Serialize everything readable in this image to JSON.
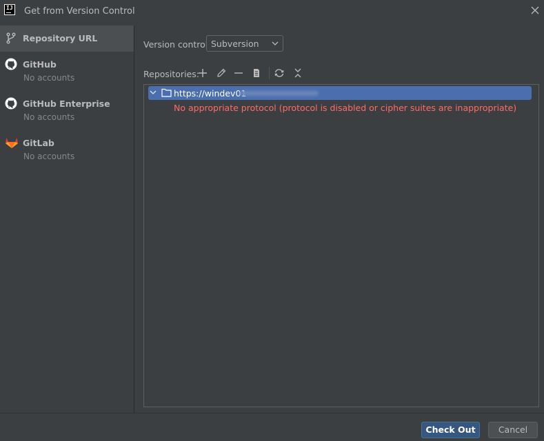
{
  "window": {
    "title": "Get from Version Control",
    "app_icon_text": "IJ"
  },
  "sidebar": {
    "items": [
      {
        "label": "Repository URL",
        "sub": "",
        "icon": "branch-icon",
        "selected": true
      },
      {
        "label": "GitHub",
        "sub": "No accounts",
        "icon": "github-icon",
        "selected": false
      },
      {
        "label": "GitHub Enterprise",
        "sub": "No accounts",
        "icon": "github-icon",
        "selected": false
      },
      {
        "label": "GitLab",
        "sub": "No accounts",
        "icon": "gitlab-icon",
        "selected": false
      }
    ]
  },
  "main": {
    "version_control_label": "Version control:",
    "version_control_value": "Subversion",
    "repositories_label": "Repositories:",
    "toolbar": [
      "add-icon",
      "edit-icon",
      "remove-icon",
      "copy-icon",
      "refresh-icon",
      "collapse-all-icon"
    ],
    "repository": {
      "url": "https://windev01",
      "error": "No appropriate protocol (protocol is disabled or cipher suites are inappropriate)"
    }
  },
  "footer": {
    "primary_button": "Check Out",
    "secondary_button": "Cancel"
  },
  "colors": {
    "background": "#3c3f41",
    "selection": "#4b6eaf",
    "error": "#ff6b68",
    "primary_button": "#365880"
  }
}
